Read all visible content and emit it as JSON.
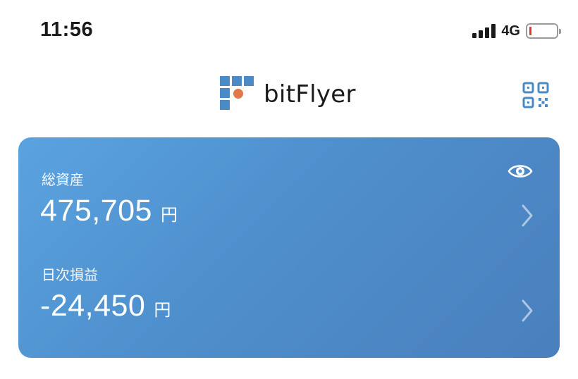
{
  "status_bar": {
    "time": "11:56",
    "network": "4G",
    "icons": [
      "signal-icon",
      "battery-icon"
    ],
    "battery_level_color": "#e5332a"
  },
  "header": {
    "logo_text": "bitFlyer",
    "icons": [
      "bitflyer-logo-icon",
      "qr-code-icon"
    ],
    "brand_blue": "#4a8ac6",
    "brand_orange": "#e2774a"
  },
  "asset_card": {
    "background_start": "#5aa3e0",
    "background_end": "#4a7fbd",
    "visibility_icon": "eye-icon",
    "total_assets": {
      "label": "総資産",
      "value": "475,705",
      "unit": "円"
    },
    "daily_pnl": {
      "label": "日次損益",
      "value": "-24,450",
      "unit": "円"
    },
    "row_icon": "chevron-right-icon"
  }
}
